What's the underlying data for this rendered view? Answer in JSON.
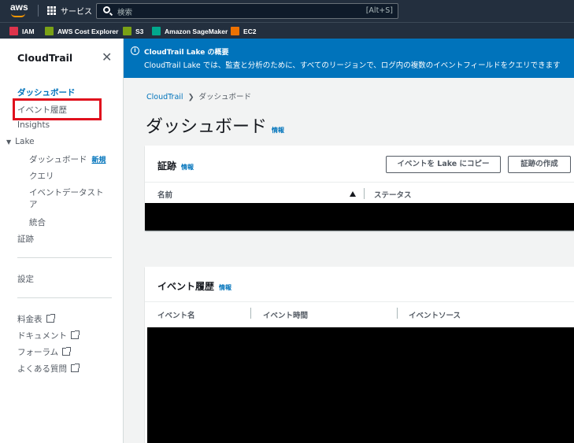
{
  "topnav": {
    "logo": "aws",
    "services_label": "サービス",
    "search_placeholder": "検索",
    "search_shortcut": "[Alt+S]"
  },
  "favorites": [
    {
      "label": "IAM",
      "icon": "iam-icon",
      "color": "#dd344c"
    },
    {
      "label": "AWS Cost Explorer",
      "icon": "cost-explorer-icon",
      "color": "#7aa116"
    },
    {
      "label": "S3",
      "icon": "s3-icon",
      "color": "#7aa116"
    },
    {
      "label": "Amazon SageMaker",
      "icon": "sagemaker-icon",
      "color": "#01a88d"
    },
    {
      "label": "EC2",
      "icon": "ec2-icon",
      "color": "#ed7100"
    }
  ],
  "sidebar": {
    "title": "CloudTrail",
    "items": {
      "dashboard": "ダッシュボード",
      "event_history": "イベント履歴",
      "insights": "Insights",
      "lake": "Lake",
      "lake_dashboard": "ダッシュボード",
      "lake_dashboard_badge": "新規",
      "query": "クエリ",
      "event_data_store_line1": "イベントデータスト",
      "event_data_store_line2": "ア",
      "integration": "統合",
      "trails": "証跡",
      "settings": "設定",
      "pricing": "料金表",
      "documentation": "ドキュメント",
      "forums": "フォーラム",
      "faq": "よくある質問"
    }
  },
  "banner": {
    "title": "CloudTrail Lake の概要",
    "text": "CloudTrail Lake では、監査と分析のために、すべてのリージョンで、ログ内の複数のイベントフィールドをクエリできます"
  },
  "breadcrumb": {
    "root": "CloudTrail",
    "current": "ダッシュボード"
  },
  "page": {
    "title": "ダッシュボード",
    "info": "情報"
  },
  "trails_panel": {
    "title": "証跡",
    "info": "情報",
    "copy_to_lake_button": "イベントを Lake にコピー",
    "create_trail_button": "証跡の作成",
    "columns": [
      "名前",
      "ステータス"
    ]
  },
  "event_history_panel": {
    "title": "イベント履歴",
    "info": "情報",
    "columns": [
      "イベント名",
      "イベント時間",
      "イベントソース"
    ]
  },
  "colors": {
    "nav_bg": "#232f3e",
    "link": "#0073bb",
    "banner": "#0073bb",
    "highlight": "#e0101d"
  }
}
